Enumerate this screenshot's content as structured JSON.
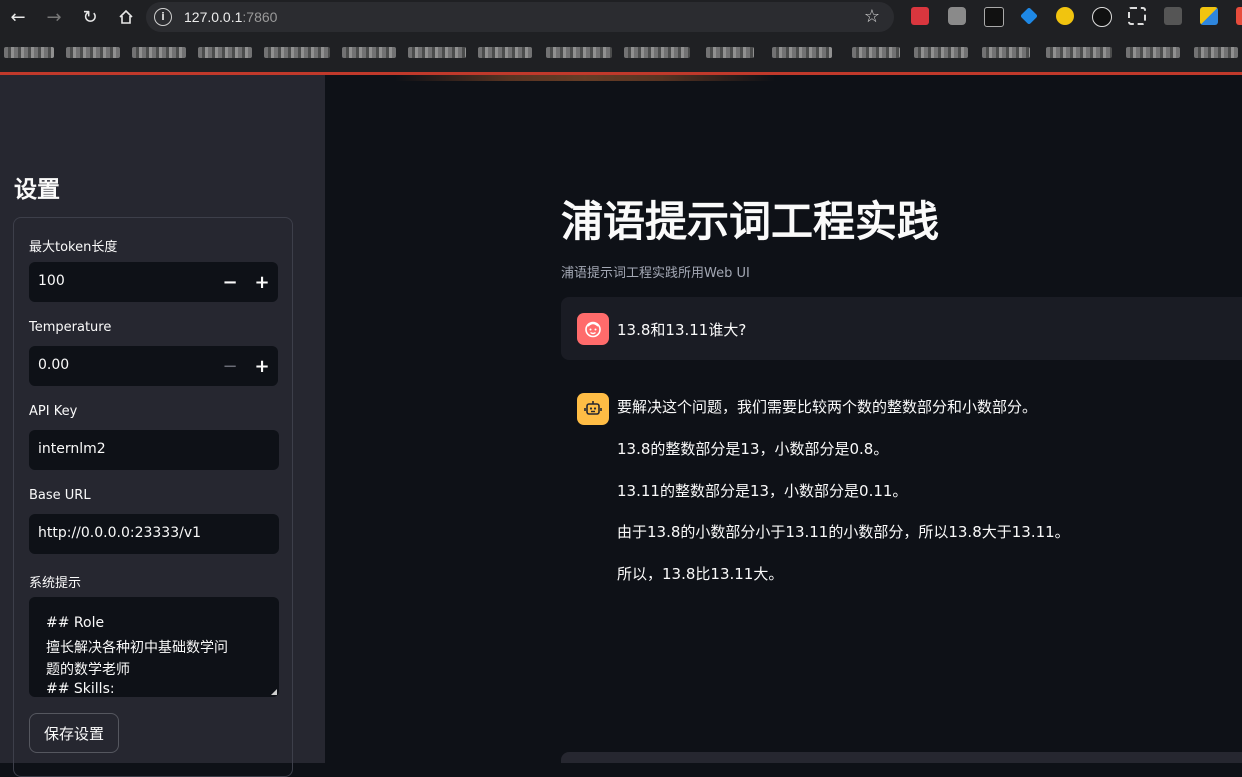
{
  "browser": {
    "url_host": "127.0.0.1",
    "url_port": ":7860"
  },
  "sidebar": {
    "title": "设置",
    "max_tokens_label": "最大token长度",
    "max_tokens_value": "100",
    "temperature_label": "Temperature",
    "temperature_value": "0.00",
    "api_key_label": "API Key",
    "api_key_value": "internlm2",
    "base_url_label": "Base URL",
    "base_url_value": "http://0.0.0.0:23333/v1",
    "system_prompt_label": "系统提示",
    "system_prompt_lines": [
      "## Role",
      "擅长解决各种初中基础数学问",
      "题的数学老师",
      "## Skills:"
    ],
    "save_label": "保存设置"
  },
  "main": {
    "title": "浦语提示词工程实践",
    "subtitle": "浦语提示词工程实践所用Web UI",
    "user_message": "13.8和13.11谁大?",
    "assistant_lines": [
      "要解决这个问题，我们需要比较两个数的整数部分和小数部分。",
      "13.8的整数部分是13，小数部分是0.8。",
      "13.11的整数部分是13，小数部分是0.11。",
      "由于13.8的小数部分小于13.11的小数部分，所以13.8大于13.11。",
      "所以，13.8比13.11大。"
    ]
  },
  "icons": {
    "user_avatar": "face-icon",
    "bot_avatar": "robot-icon"
  },
  "colors": {
    "user_avatar": "#ff6b6b",
    "bot_avatar": "#ffbd45",
    "sidebar_bg": "#262730",
    "main_bg": "#0e1117"
  }
}
